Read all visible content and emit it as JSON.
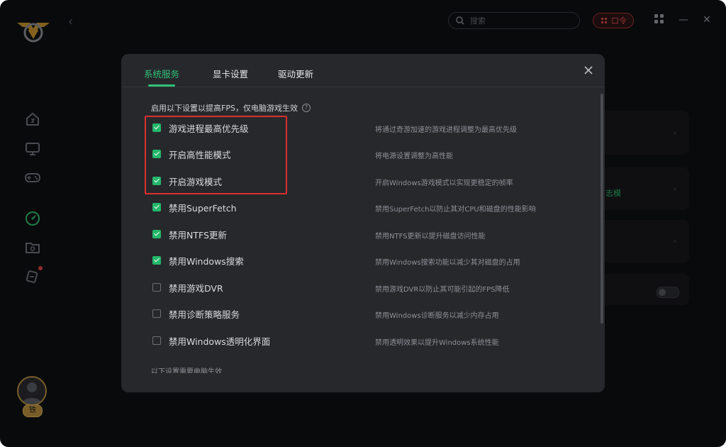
{
  "topbar": {
    "search_placeholder": "搜索",
    "command_label": "口令"
  },
  "background": {
    "card2_text": "志模"
  },
  "modal": {
    "tabs": [
      {
        "label": "系统服务",
        "active": true
      },
      {
        "label": "显卡设置",
        "active": false
      },
      {
        "label": "驱动更新",
        "active": false
      }
    ],
    "intro": "启用以下设置以提高FPS，仅电脑游戏生效",
    "options": [
      {
        "label": "游戏进程最高优先级",
        "desc": "将通过奇游加速的游戏进程调整为最高优先级",
        "checked": true
      },
      {
        "label": "开启高性能模式",
        "desc": "将电源设置调整为高性能",
        "checked": true
      },
      {
        "label": "开启游戏模式",
        "desc": "开启Windows游戏模式以实现更稳定的帧率",
        "checked": true
      },
      {
        "label": "禁用SuperFetch",
        "desc": "禁用SuperFetch以防止其对CPU和磁盘的性能影响",
        "checked": true
      },
      {
        "label": "禁用NTFS更新",
        "desc": "禁用NTFS更新以提升磁盘访问性能",
        "checked": true
      },
      {
        "label": "禁用Windows搜索",
        "desc": "禁用Windows搜索功能以减少其对磁盘的占用",
        "checked": true
      },
      {
        "label": "禁用游戏DVR",
        "desc": "禁用游戏DVR以防止其可能引起的FPS降低",
        "checked": false
      },
      {
        "label": "禁用诊断策略服务",
        "desc": "禁用Windows诊断服务以减少内存占用",
        "checked": false
      },
      {
        "label": "禁用Windows透明化界面",
        "desc": "禁用透明效果以提升Windows系统性能",
        "checked": false
      }
    ],
    "footer_cut": "以下设置需要电脑生效"
  },
  "user": {
    "badge": "铁"
  },
  "colors": {
    "accent": "#2fc277",
    "highlight": "#d9302f",
    "modal_bg": "#27282c",
    "app_bg": "#0f1013"
  }
}
